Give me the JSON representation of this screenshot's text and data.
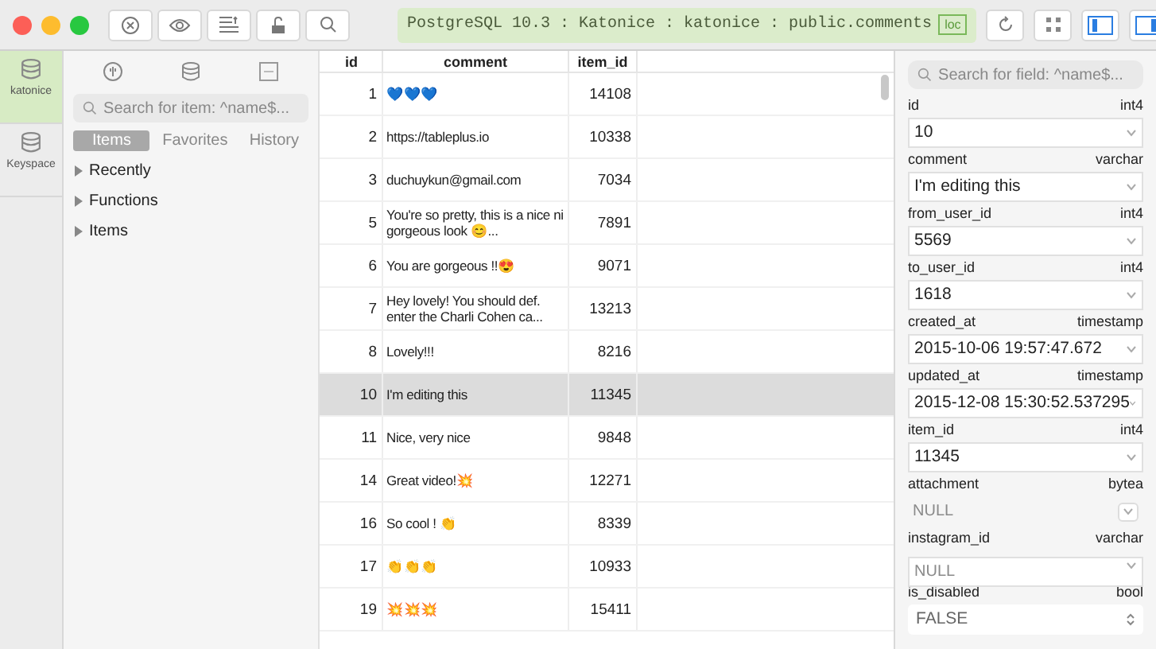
{
  "window": {
    "title": "PostgreSQL 10.3 : Katonice : katonice : public.comments",
    "badge": "loc"
  },
  "connections": [
    {
      "label": "katonice",
      "selected": true
    },
    {
      "label": "Keyspace",
      "selected": false
    }
  ],
  "sidebar": {
    "search": {
      "placeholder": "Search for item: ^name$..."
    },
    "tabs": [
      {
        "label": "Items",
        "selected": true
      },
      {
        "label": "Favorites",
        "selected": false
      },
      {
        "label": "History",
        "selected": false
      }
    ],
    "items": [
      {
        "label": "Recently",
        "expanded": false
      },
      {
        "label": "Functions",
        "expanded": false
      },
      {
        "label": "Items",
        "expanded": false
      }
    ]
  },
  "table": {
    "columns": [
      "id",
      "comment",
      "item_id"
    ],
    "rows": [
      {
        "cells": [
          "1",
          "💙💙💙",
          "14108"
        ],
        "selected": false
      },
      {
        "cells": [
          "2",
          "https://tableplus.io",
          "10338"
        ],
        "selected": false
      },
      {
        "cells": [
          "3",
          "duchuykun@gmail.com",
          "7034"
        ],
        "selected": false
      },
      {
        "cells": [
          "5",
          "You're so pretty, this is a nice ni gorgeous look 😊...",
          "7891"
        ],
        "selected": false
      },
      {
        "cells": [
          "6",
          "You are gorgeous !!😍",
          "9071"
        ],
        "selected": false
      },
      {
        "cells": [
          "7",
          "Hey lovely! You should def. enter the Charli Cohen ca...",
          "13213"
        ],
        "selected": false
      },
      {
        "cells": [
          "8",
          "Lovely!!!",
          "8216"
        ],
        "selected": false
      },
      {
        "cells": [
          "10",
          "I'm editing this",
          "11345"
        ],
        "selected": true
      },
      {
        "cells": [
          "11",
          "Nice, very nice",
          "9848"
        ],
        "selected": false
      },
      {
        "cells": [
          "14",
          "Great video!💥",
          "12271"
        ],
        "selected": false
      },
      {
        "cells": [
          "16",
          "So cool ! 👏",
          "8339"
        ],
        "selected": false
      },
      {
        "cells": [
          "17",
          "👏👏👏",
          "10933"
        ],
        "selected": false
      },
      {
        "cells": [
          "19",
          "💥💥💥",
          "15411"
        ],
        "selected": false
      }
    ]
  },
  "inspector": {
    "search": {
      "placeholder": "Search for field: ^name$..."
    },
    "fields": [
      {
        "name": "id",
        "type": "int4",
        "value": "10",
        "kind": "value"
      },
      {
        "name": "comment",
        "type": "varchar",
        "value": "I'm editing this",
        "kind": "value"
      },
      {
        "name": "from_user_id",
        "type": "int4",
        "value": "5569",
        "kind": "value"
      },
      {
        "name": "to_user_id",
        "type": "int4",
        "value": "1618",
        "kind": "value"
      },
      {
        "name": "created_at",
        "type": "timestamp",
        "value": "2015-10-06 19:57:47.672",
        "kind": "value"
      },
      {
        "name": "updated_at",
        "type": "timestamp",
        "value": "2015-12-08 15:30:52.537295",
        "kind": "value"
      },
      {
        "name": "item_id",
        "type": "int4",
        "value": "11345",
        "kind": "value"
      },
      {
        "name": "attachment",
        "type": "bytea",
        "placeholder": "NULL",
        "kind": "binary"
      },
      {
        "name": "instagram_id",
        "type": "varchar",
        "placeholder": "NULL",
        "kind": "null"
      },
      {
        "name": "is_disabled",
        "type": "bool",
        "value": "FALSE",
        "kind": "select"
      }
    ]
  }
}
